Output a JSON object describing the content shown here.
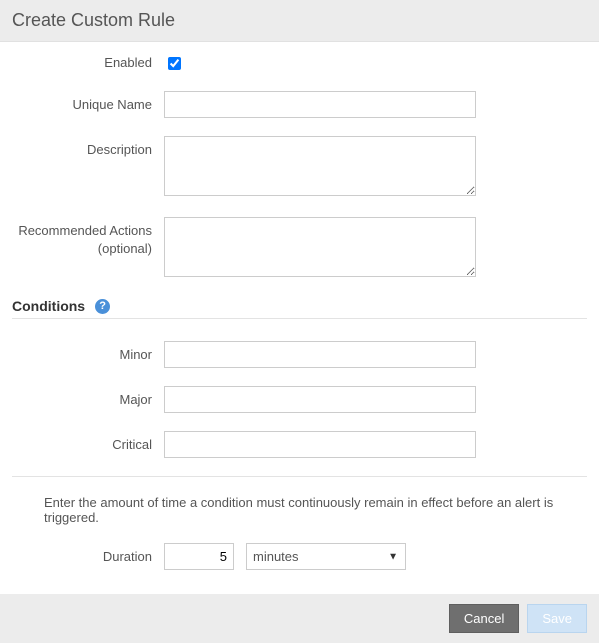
{
  "header": {
    "title": "Create Custom Rule"
  },
  "form": {
    "enabled_label": "Enabled",
    "enabled_checked": true,
    "unique_name_label": "Unique Name",
    "unique_name_value": "",
    "description_label": "Description",
    "description_value": "",
    "recommended_actions_label": "Recommended Actions (optional)",
    "recommended_actions_value": ""
  },
  "conditions": {
    "heading": "Conditions",
    "minor_label": "Minor",
    "minor_value": "",
    "major_label": "Major",
    "major_value": "",
    "critical_label": "Critical",
    "critical_value": ""
  },
  "duration": {
    "hint": "Enter the amount of time a condition must continuously remain in effect before an alert is triggered.",
    "label": "Duration",
    "value": "5",
    "unit_selected": "minutes"
  },
  "footer": {
    "cancel": "Cancel",
    "save": "Save"
  }
}
